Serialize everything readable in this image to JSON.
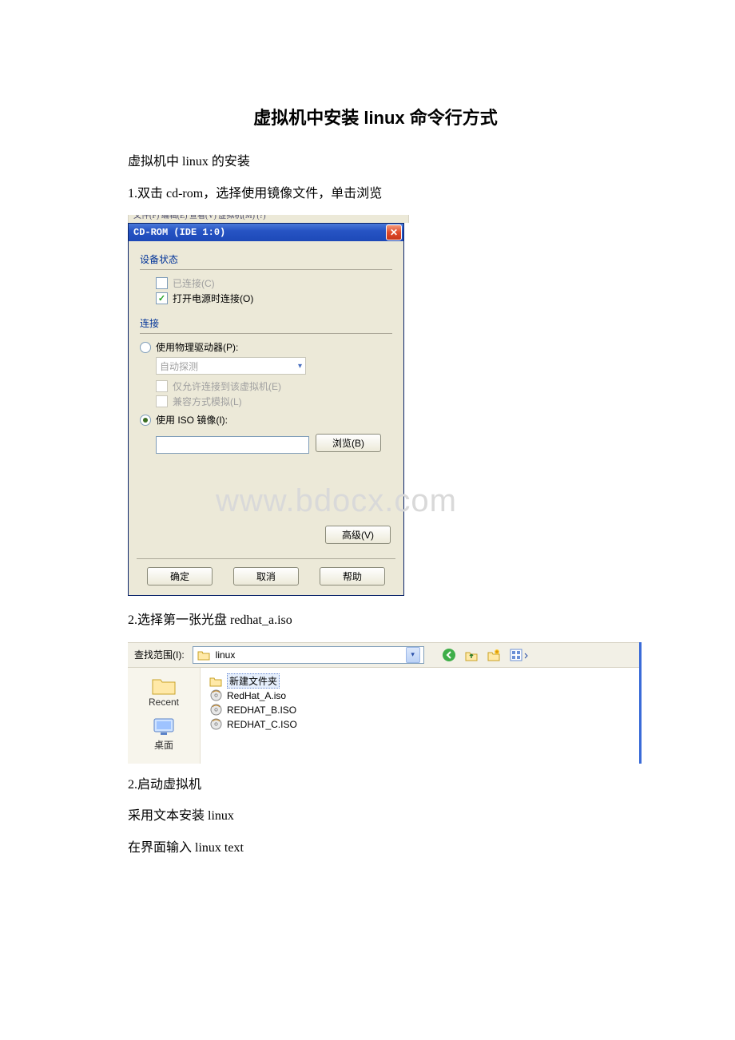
{
  "title": "虚拟机中安装 linux 命令行方式",
  "p1": "虚拟机中 linux 的安装",
  "p2": "1.双击 cd-rom，选择使用镜像文件，单击浏览",
  "menubar_fragment": "文件(F)    编辑(E)    查看(V)    虚拟机(M)    (?)",
  "dlg1": {
    "title": "CD-ROM (IDE 1:0)",
    "sec_status": "设备状态",
    "cb_connected": "已连接(C)",
    "cb_poweron": "打开电源时连接(O)",
    "sec_conn": "连接",
    "rb_physical": "使用物理驱动器(P):",
    "combo_auto": "自动探测",
    "cb_onlyvm": "仅允许连接到该虚拟机(E)",
    "cb_legacy": "兼容方式模拟(L)",
    "rb_iso": "使用 ISO 镜像(I):",
    "btn_browse": "浏览(B)",
    "btn_adv": "高级(V)",
    "btn_ok": "确定",
    "btn_cancel": "取消",
    "btn_help": "帮助"
  },
  "watermark": "www.bdocx.com",
  "p3": "2.选择第一张光盘 redhat_a.iso",
  "dlg2": {
    "lookin_label": "查找范围(I):",
    "lookin_value": "linux",
    "files": {
      "f0": "新建文件夹",
      "f1": "RedHat_A.iso",
      "f2": "REDHAT_B.ISO",
      "f3": "REDHAT_C.ISO"
    },
    "place_recent": "Recent",
    "place_desktop": "桌面"
  },
  "p4": "2.启动虚拟机",
  "p5": "采用文本安装 linux",
  "p6": "在界面输入 linux text"
}
